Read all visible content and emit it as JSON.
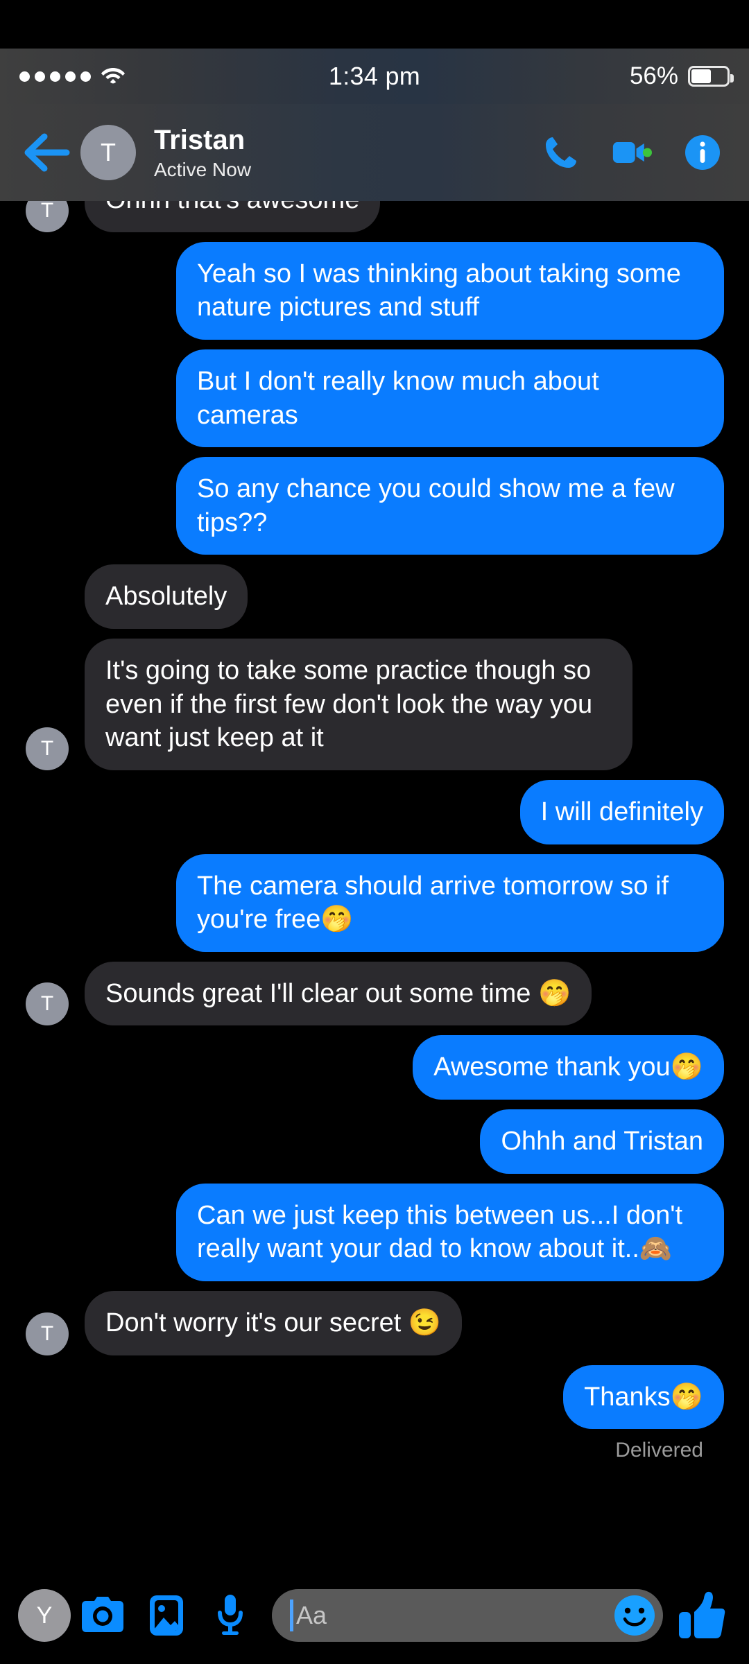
{
  "statusbar": {
    "signal_icon": "signal-dots-icon",
    "wifi_icon": "wifi-icon",
    "time": "1:34 pm",
    "battery_percent": "56%",
    "battery_level": 56
  },
  "header": {
    "back_icon": "back-arrow-icon",
    "avatar_initial": "T",
    "title": "Tristan",
    "subtitle": "Active Now",
    "call_icon": "phone-icon",
    "video_icon": "video-camera-icon",
    "info_icon": "info-icon",
    "active_dot_color": "#3dc43d"
  },
  "colors": {
    "outgoing_bubble": "#0a7cff",
    "incoming_bubble": "#2b2a2e",
    "background": "#000000",
    "avatar": "#9195a0"
  },
  "messages": [
    {
      "id": 0,
      "side": "in",
      "text": "Ohhh that's awesome",
      "avatar": "T",
      "show_avatar": true,
      "clipped": true
    },
    {
      "id": 1,
      "side": "out",
      "text": "Yeah so I was thinking about taking some nature pictures and stuff"
    },
    {
      "id": 2,
      "side": "out",
      "text": "But I don't really know much about cameras"
    },
    {
      "id": 3,
      "side": "out",
      "text": "So any chance you could show me a few tips??"
    },
    {
      "id": 4,
      "side": "in",
      "text": "Absolutely",
      "show_avatar": false
    },
    {
      "id": 5,
      "side": "in",
      "text": "It's going to take some practice though so even if the first few don't look the way you want just keep at it",
      "avatar": "T",
      "show_avatar": true
    },
    {
      "id": 6,
      "side": "out",
      "text": "I will definitely"
    },
    {
      "id": 7,
      "side": "out",
      "text": "The camera should arrive tomorrow so if you're free🤭"
    },
    {
      "id": 8,
      "side": "in",
      "text": "Sounds great I'll clear out some time 🤭",
      "avatar": "T",
      "show_avatar": true
    },
    {
      "id": 9,
      "side": "out",
      "text": "Awesome thank you🤭"
    },
    {
      "id": 10,
      "side": "out",
      "text": "Ohhh and Tristan"
    },
    {
      "id": 11,
      "side": "out",
      "text": "Can we just keep this between us...I don't really want your dad to know about it..🙈"
    },
    {
      "id": 12,
      "side": "in",
      "text": "Don't worry it's our secret 😉",
      "avatar": "T",
      "show_avatar": true
    },
    {
      "id": 13,
      "side": "out",
      "text": "Thanks🤭"
    }
  ],
  "status": {
    "delivered_label": "Delivered"
  },
  "composer": {
    "avatar_initial": "Y",
    "camera_icon": "camera-icon",
    "gallery_icon": "photo-gallery-icon",
    "mic_icon": "microphone-icon",
    "input_placeholder": "Aa",
    "input_value": "",
    "emoji_icon": "smiley-face-icon",
    "like_icon": "thumbs-up-icon"
  }
}
